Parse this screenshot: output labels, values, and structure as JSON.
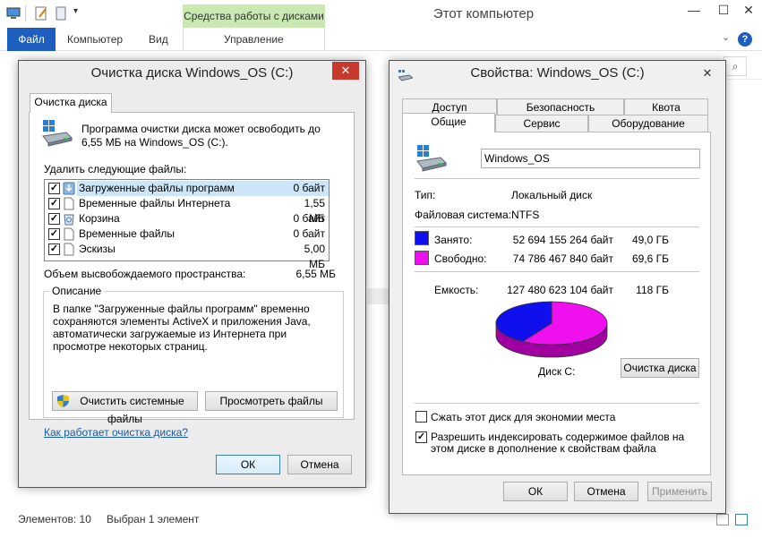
{
  "explorer": {
    "title": "Этот компьютер",
    "context_group": "Средства работы с дисками",
    "tabs": {
      "file": "Файл",
      "computer": "Компьютер",
      "view": "Вид",
      "manage": "Управление"
    },
    "window_buttons": {
      "minimize": "—",
      "maximize": "☐",
      "close": "✕"
    },
    "help": "?",
    "search_icon": "search-icon",
    "status": {
      "elements": "Элементов: 10",
      "selected": "Выбран 1 элемент"
    }
  },
  "cleanup": {
    "title": "Очистка диска Windows_OS (C:)",
    "close": "✕",
    "tab": "Очистка диска",
    "intro": "Программа очистки диска может освободить до 6,55 МБ на Windows_OS (C:).",
    "list_label": "Удалить следующие файлы:",
    "files": [
      {
        "name": "Загруженные файлы программ",
        "size": "0 байт",
        "checked": true,
        "icon": "download-folder-icon"
      },
      {
        "name": "Временные файлы Интернета",
        "size": "1,55 МБ",
        "checked": true,
        "icon": "file-icon"
      },
      {
        "name": "Корзина",
        "size": "0 байт",
        "checked": true,
        "icon": "recycle-bin-icon"
      },
      {
        "name": "Временные файлы",
        "size": "0 байт",
        "checked": true,
        "icon": "file-icon"
      },
      {
        "name": "Эскизы",
        "size": "5,00 МБ",
        "checked": true,
        "icon": "file-icon"
      }
    ],
    "freed_label": "Объем высвобождаемого пространства:",
    "freed_value": "6,55 МБ",
    "desc_label": "Описание",
    "description": "В папке \"Загруженные файлы программ\" временно сохраняются элементы ActiveX и приложения Java, автоматически загружаемые из Интернета при просмотре некоторых страниц.",
    "clean_system_button": "Очистить системные файлы",
    "view_files_button": "Просмотреть файлы",
    "help_link": "Как работает очистка диска?",
    "ok_button": "ОК",
    "cancel_button": "Отмена"
  },
  "properties": {
    "title": "Свойства: Windows_OS (C:)",
    "close": "✕",
    "tabs_top": [
      "Доступ",
      "Безопасность",
      "Квота"
    ],
    "tabs_bottom": [
      "Общие",
      "Сервис",
      "Оборудование"
    ],
    "name_value": "Windows_OS",
    "type_label": "Тип:",
    "type_value": "Локальный диск",
    "fs_label": "Файловая система:",
    "fs_value": "NTFS",
    "used_label": "Занято:",
    "used_bytes": "52 694 155 264 байт",
    "used_gb": "49,0 ГБ",
    "free_label": "Свободно:",
    "free_bytes": "74 786 467 840 байт",
    "free_gb": "69,6 ГБ",
    "capacity_label": "Емкость:",
    "capacity_bytes": "127 480 623 104 байт",
    "capacity_gb": "118 ГБ",
    "used_color": "#1010ee",
    "free_color": "#ee10ee",
    "used_fraction": 0.4134,
    "disk_label": "Диск C:",
    "cleanup_button": "Очистка диска",
    "compress_label": "Сжать этот диск для экономии места",
    "compress_checked": false,
    "index_label": "Разрешить индексировать содержимое файлов на этом диске в дополнение к свойствам файла",
    "index_checked": true,
    "ok_button": "ОК",
    "cancel_button": "Отмена",
    "apply_button": "Применить"
  }
}
